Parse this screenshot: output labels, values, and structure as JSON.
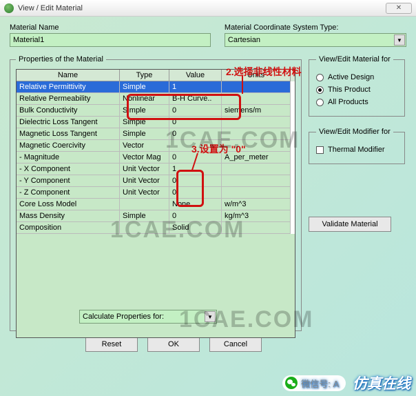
{
  "window": {
    "title": "View / Edit Material",
    "close": "✕"
  },
  "material_name": {
    "label": "Material Name",
    "value": "Material1"
  },
  "coord": {
    "label": "Material Coordinate System Type:",
    "value": "Cartesian"
  },
  "props": {
    "legend": "Properties of the Material",
    "headers": {
      "name": "Name",
      "type": "Type",
      "value": "Value",
      "units": "Units"
    },
    "rows": [
      {
        "name": "Relative Permittivity",
        "type": "Simple",
        "value": "1",
        "units": "",
        "sel": true
      },
      {
        "name": "Relative Permeability",
        "type": "Nonlinear",
        "value": "B-H Curve..",
        "units": "",
        "sel": false
      },
      {
        "name": "Bulk Conductivity",
        "type": "Simple",
        "value": "0",
        "units": "siemens/m",
        "sel": false
      },
      {
        "name": "Dielectric Loss Tangent",
        "type": "Simple",
        "value": "0",
        "units": "",
        "sel": false
      },
      {
        "name": "Magnetic Loss Tangent",
        "type": "Simple",
        "value": "0",
        "units": "",
        "sel": false
      },
      {
        "name": "Magnetic Coercivity",
        "type": "Vector",
        "value": "",
        "units": "",
        "sel": false
      },
      {
        "name": "- Magnitude",
        "type": "Vector Mag",
        "value": "0",
        "units": "A_per_meter",
        "sel": false
      },
      {
        "name": "- X Component",
        "type": "Unit Vector",
        "value": "1",
        "units": "",
        "sel": false
      },
      {
        "name": "- Y Component",
        "type": "Unit Vector",
        "value": "0",
        "units": "",
        "sel": false
      },
      {
        "name": "- Z Component",
        "type": "Unit Vector",
        "value": "0",
        "units": "",
        "sel": false
      },
      {
        "name": "Core Loss Model",
        "type": "",
        "value": "None",
        "units": "w/m^3",
        "sel": false
      },
      {
        "name": "Mass Density",
        "type": "Simple",
        "value": "0",
        "units": "kg/m^3",
        "sel": false
      },
      {
        "name": "Composition",
        "type": "",
        "value": "Solid",
        "units": "",
        "sel": false
      }
    ],
    "calc_label": "Calculate Properties for:"
  },
  "view_for": {
    "legend": "View/Edit Material for",
    "options": [
      {
        "label": "Active Design",
        "checked": false
      },
      {
        "label": "This Product",
        "checked": true
      },
      {
        "label": "All Products",
        "checked": false
      }
    ]
  },
  "modifier": {
    "legend": "View/Edit Modifier for",
    "thermal": "Thermal Modifier"
  },
  "validate": "Validate Material",
  "buttons": {
    "reset": "Reset",
    "ok": "OK",
    "cancel": "Cancel"
  },
  "annot": {
    "a2": "2.选择非线性材料",
    "a3": "3.设置为 \"0\""
  },
  "watermark": "1CAE.COM",
  "footer": {
    "wechat": "微信号: A",
    "brand": "仿真在线"
  }
}
